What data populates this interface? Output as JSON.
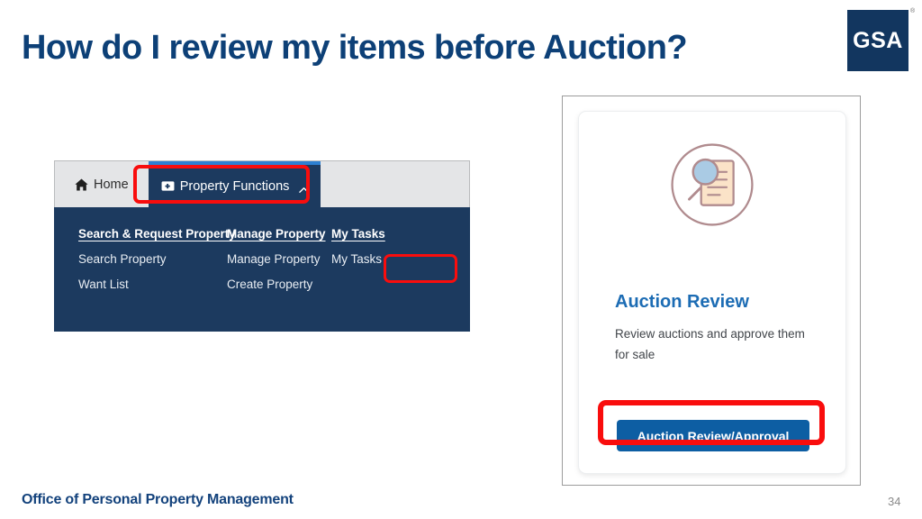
{
  "slide": {
    "title": "How do I review my items before Auction?",
    "footer": "Office of Personal Property Management",
    "page_number": "34"
  },
  "logo": {
    "text": "GSA",
    "trademark": "®",
    "background_color": "#12365f"
  },
  "nav": {
    "tabs": [
      {
        "label": "Home",
        "icon": "home-icon",
        "active": false
      },
      {
        "label": "Property Functions",
        "icon": "folder-plus-icon",
        "chevron": "chevron-up-icon",
        "active": true
      }
    ],
    "active_tab_accent_color": "#2d80d2",
    "bar_background_color": "#e4e5e7",
    "dropdown_background_color": "#1c3a5f",
    "dropdown": {
      "columns": [
        {
          "heading": "Search & Request Property",
          "items": [
            "Search Property",
            "Want List"
          ]
        },
        {
          "heading": "Manage Property",
          "items": [
            "Manage Property",
            "Create Property"
          ]
        },
        {
          "heading": "My Tasks",
          "items": [
            "My Tasks"
          ]
        }
      ]
    }
  },
  "card": {
    "icon": "magnifier-document-icon",
    "heading": "Auction Review",
    "heading_color": "#1c6cb4",
    "description": "Review auctions and approve them for sale",
    "button_label": "Auction Review/Approval",
    "button_color": "#0d5ea3"
  },
  "annotations": {
    "highlight_color": "#f90d0d",
    "boxes": [
      {
        "target": "Property Functions"
      },
      {
        "target": "My Tasks"
      },
      {
        "target": "Auction Review/Approval"
      }
    ]
  }
}
